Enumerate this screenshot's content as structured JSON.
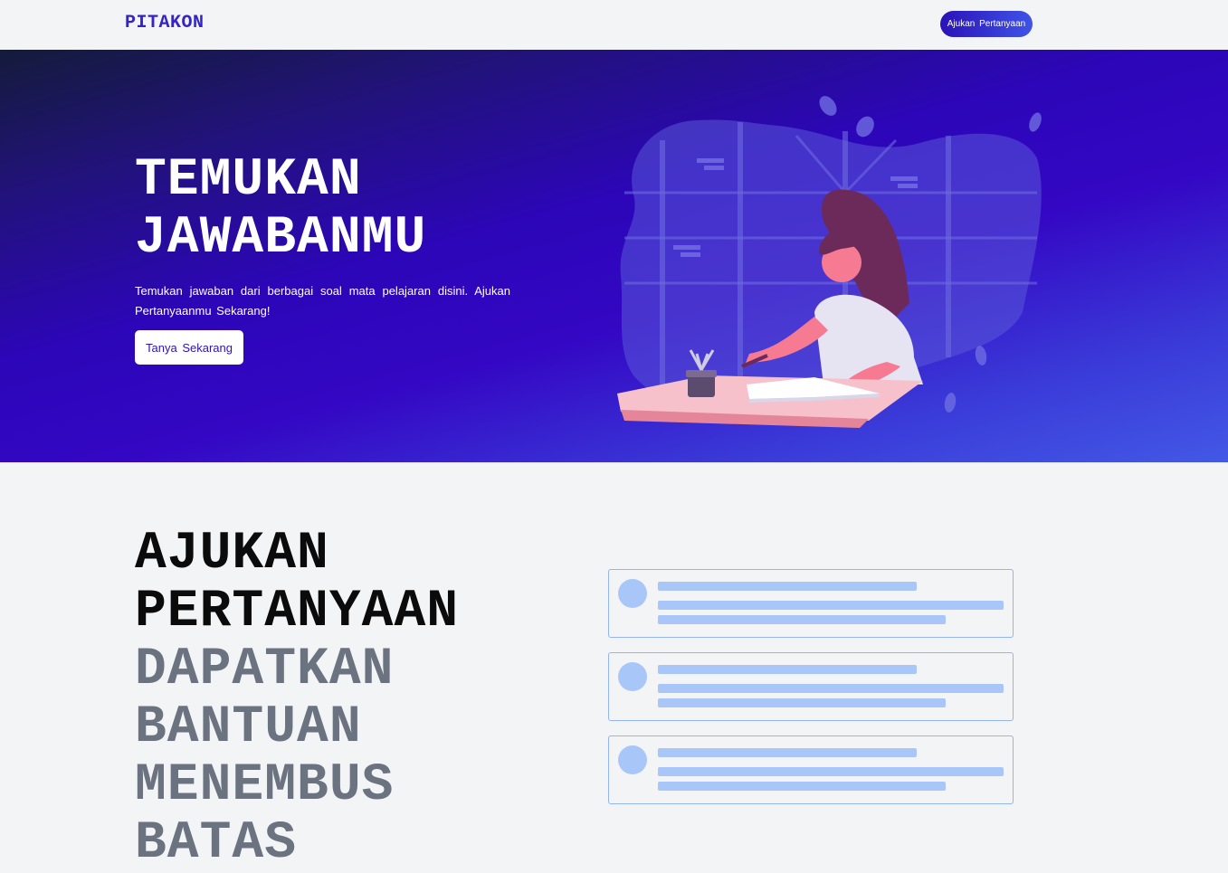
{
  "navbar": {
    "brand": "PITAKON",
    "cta_label": "Ajukan Pertanyaan"
  },
  "hero": {
    "title_lines": [
      "TEMUKAN",
      "JAWABANMU"
    ],
    "description": "Temukan jawaban dari berbagai soal mata pelajaran disini. Ajukan Pertanyaanmu Sekarang!",
    "button_label": "Tanya Sekarang"
  },
  "feature": {
    "title_dark_lines": [
      "AJUKAN",
      "PERTANYAAN"
    ],
    "title_gray_lines": [
      "DAPATKAN",
      "BANTUAN",
      "MENEMBUS",
      "BATAS"
    ],
    "placeholder_cards": 3
  },
  "colors": {
    "brand": "#3423c6",
    "hero_gradient_start": "#141b3b",
    "hero_gradient_mid": "#3407c4",
    "hero_gradient_end": "#4358e6",
    "skeleton": "#a9c6f8",
    "title_gray": "#6b7280"
  },
  "icons": [
    "study-illustration"
  ]
}
